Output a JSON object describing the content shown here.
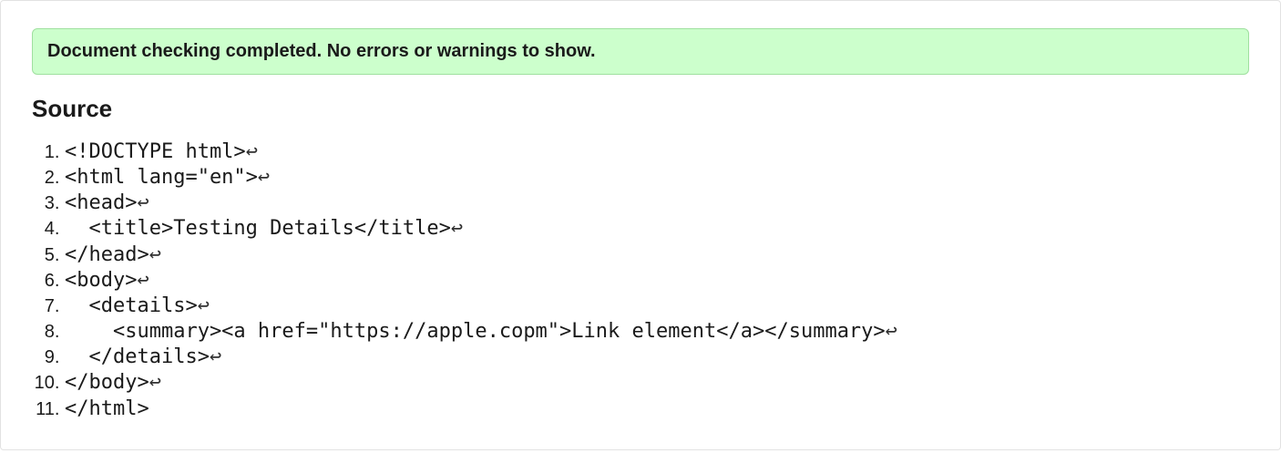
{
  "banner": {
    "message": "Document checking completed. No errors or warnings to show."
  },
  "source": {
    "heading": "Source",
    "eol_symbol": "↩",
    "lines": [
      "<!DOCTYPE html>",
      "<html lang=\"en\">",
      "<head>",
      "  <title>Testing Details</title>",
      "</head>",
      "<body>",
      "  <details>",
      "    <summary><a href=\"https://apple.copm\">Link element</a></summary>",
      "  </details>",
      "</body>",
      "</html>"
    ]
  }
}
